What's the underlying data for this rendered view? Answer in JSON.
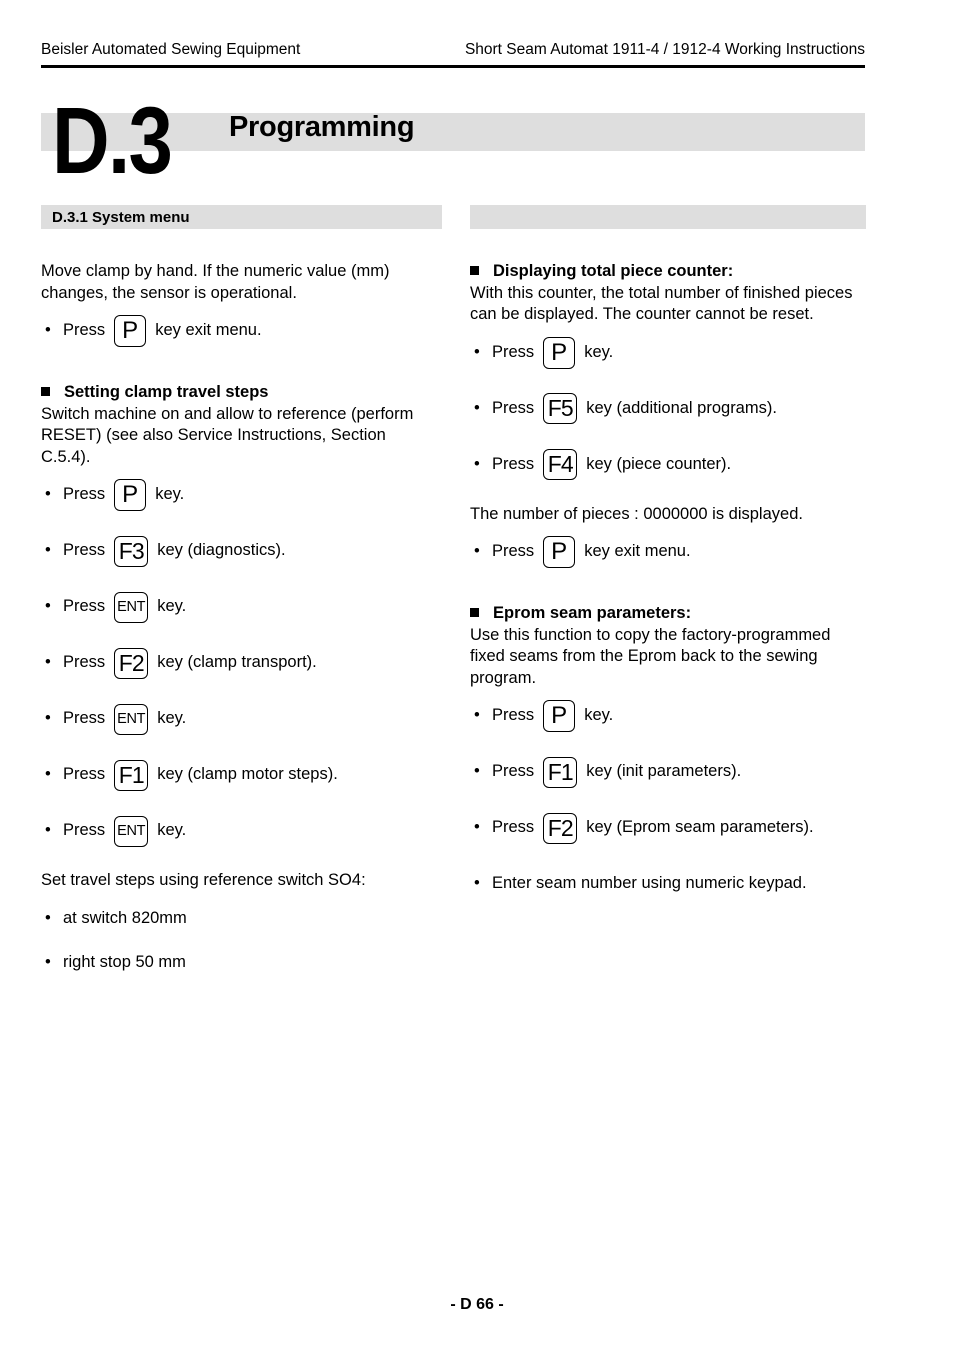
{
  "header": {
    "left": "Beisler Automated Sewing Equipment",
    "right": "Short Seam Automat 1911-4 / 1912-4 Working Instructions"
  },
  "chapter": {
    "number": "D.3",
    "title": "Programming"
  },
  "left_column": {
    "section_band": "D.3.1 System menu",
    "intro": "Move clamp by hand. If the numeric value (mm) changes, the sensor is operational.",
    "intro_step": {
      "press": "Press",
      "key": "P",
      "tail": "key exit menu."
    },
    "subhead": "Setting clamp travel steps",
    "subhead_body": "Switch machine on and allow to reference (perform RESET) (see also Service Instructions, Section C.5.4).",
    "steps": [
      {
        "press": "Press",
        "key": "P",
        "key_type": "wide",
        "tail": "key."
      },
      {
        "press": "Press",
        "key": "F3",
        "key_type": "fn",
        "tail": "key (diagnostics)."
      },
      {
        "press": "Press",
        "key": "ENT",
        "key_type": "ent",
        "tail": "key."
      },
      {
        "press": "Press",
        "key": "F2",
        "key_type": "fn",
        "tail": "key (clamp transport)."
      },
      {
        "press": "Press",
        "key": "ENT",
        "key_type": "ent",
        "tail": "key."
      },
      {
        "press": "Press",
        "key": "F1",
        "key_type": "fn",
        "tail": "key (clamp motor steps)."
      },
      {
        "press": "Press",
        "key": "ENT",
        "key_type": "ent",
        "tail": "key."
      }
    ],
    "closing_para": "Set travel steps using reference switch SO4:",
    "closing_bullets": [
      "at switch 820mm",
      "right stop 50 mm"
    ]
  },
  "right_column": {
    "section_band": "",
    "block1": {
      "subhead": "Displaying total piece counter:",
      "body": "With this counter, the total number of finished pieces can be displayed. The counter cannot be reset.",
      "steps": [
        {
          "press": "Press",
          "key": "P",
          "key_type": "wide",
          "tail": "key."
        },
        {
          "press": "Press",
          "key": "F5",
          "key_type": "fn",
          "tail": "key (additional programs)."
        },
        {
          "press": "Press",
          "key": "F4",
          "key_type": "fn",
          "tail": "key (piece counter)."
        }
      ],
      "result_para": "The number of pieces : 0000000 is displayed.",
      "exit_step": {
        "press": "Press",
        "key": "P",
        "key_type": "wide",
        "tail": "key exit menu."
      }
    },
    "block2": {
      "subhead": "Eprom seam parameters:",
      "body": "Use this function to copy the factory-programmed fixed seams from the Eprom back to the sewing program.",
      "steps": [
        {
          "press": "Press",
          "key": "P",
          "key_type": "wide",
          "tail": "key."
        },
        {
          "press": "Press",
          "key": "F1",
          "key_type": "fn",
          "tail": "key (init parameters)."
        },
        {
          "press": "Press",
          "key": "F2",
          "key_type": "fn",
          "tail": "key (Eprom seam parameters)."
        }
      ],
      "final_bullet": "Enter seam number using numeric keypad."
    }
  },
  "footer": {
    "page_label": "- D 66 -"
  },
  "bullet_glyph": "•",
  "colors": {
    "band_gray": "#dedede",
    "text": "#000000"
  }
}
